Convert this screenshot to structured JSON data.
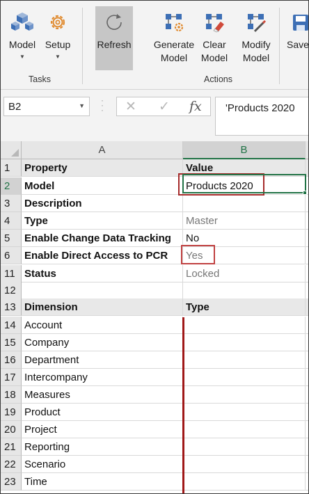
{
  "ribbon": {
    "buttons": [
      {
        "label1": "Model",
        "label2": "",
        "caret": true,
        "icon": "model-cubes-icon"
      },
      {
        "label1": "Setup",
        "label2": "",
        "caret": true,
        "icon": "gear-icon"
      },
      {
        "label1": "Refresh",
        "label2": "",
        "caret": false,
        "icon": "refresh-icon"
      },
      {
        "label1": "Generate",
        "label2": "Model",
        "caret": false,
        "icon": "generate-model-icon"
      },
      {
        "label1": "Clear",
        "label2": "Model",
        "caret": false,
        "icon": "clear-model-icon"
      },
      {
        "label1": "Modify",
        "label2": "Model",
        "caret": false,
        "icon": "modify-model-icon"
      },
      {
        "label1": "Save",
        "label2": "",
        "caret": false,
        "icon": "save-icon"
      }
    ],
    "groups": {
      "tasks": "Tasks",
      "actions": "Actions"
    }
  },
  "formula_bar": {
    "name_box": "B2",
    "fx": "fx",
    "content": "'Products 2020"
  },
  "grid": {
    "columns": [
      "A",
      "B"
    ],
    "rows": [
      {
        "num": "1",
        "a": "Property",
        "b": "Value"
      },
      {
        "num": "2",
        "a": "Model",
        "b": "Products 2020"
      },
      {
        "num": "3",
        "a": "Description",
        "b": ""
      },
      {
        "num": "4",
        "a": "Type",
        "b": "Master"
      },
      {
        "num": "5",
        "a": "Enable Change Data Tracking",
        "b": "No"
      },
      {
        "num": "6",
        "a": "Enable Direct Access to PCR",
        "b": "Yes"
      },
      {
        "num": "11",
        "a": "Status",
        "b": "Locked"
      },
      {
        "num": "12",
        "a": "",
        "b": ""
      },
      {
        "num": "13",
        "a": "Dimension",
        "b": "Type"
      },
      {
        "num": "14",
        "a": "Account",
        "b": ""
      },
      {
        "num": "15",
        "a": "Company",
        "b": ""
      },
      {
        "num": "16",
        "a": "Department",
        "b": ""
      },
      {
        "num": "17",
        "a": "Intercompany",
        "b": ""
      },
      {
        "num": "18",
        "a": "Measures",
        "b": ""
      },
      {
        "num": "19",
        "a": "Product",
        "b": ""
      },
      {
        "num": "20",
        "a": "Project",
        "b": ""
      },
      {
        "num": "21",
        "a": "Reporting",
        "b": ""
      },
      {
        "num": "22",
        "a": "Scenario",
        "b": ""
      },
      {
        "num": "23",
        "a": "Time",
        "b": ""
      }
    ]
  },
  "colors": {
    "accent": "#217346",
    "highlight": "#a52a2a"
  }
}
